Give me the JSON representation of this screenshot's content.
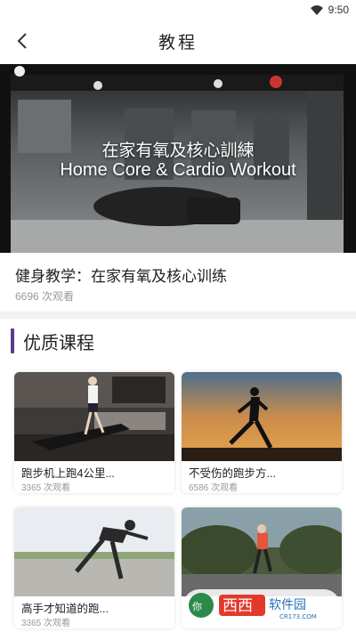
{
  "status_bar": {
    "time": "9:50",
    "icons": [
      "wifi-icon"
    ]
  },
  "header": {
    "title": "教程",
    "back_icon": "back-arrow-icon"
  },
  "video": {
    "overlay_zh": "在家有氧及核心訓練",
    "overlay_en": "Home Core & Cardio Workout",
    "title": "健身教学：在家有氧及核心训练",
    "views": "6696 次观看"
  },
  "section": {
    "title": "优质课程",
    "accent": "#5b3b8c"
  },
  "courses": [
    {
      "title": "跑步机上跑4公里...",
      "views": "3365 次观看"
    },
    {
      "title": "不受伤的跑步方...",
      "views": "6586 次观看"
    },
    {
      "title": "高手才知道的跑...",
      "views": "3365 次观看"
    },
    {
      "title": "",
      "views": ""
    }
  ],
  "watermark": {
    "text": "西西软件园",
    "url": "CR173.COM"
  }
}
